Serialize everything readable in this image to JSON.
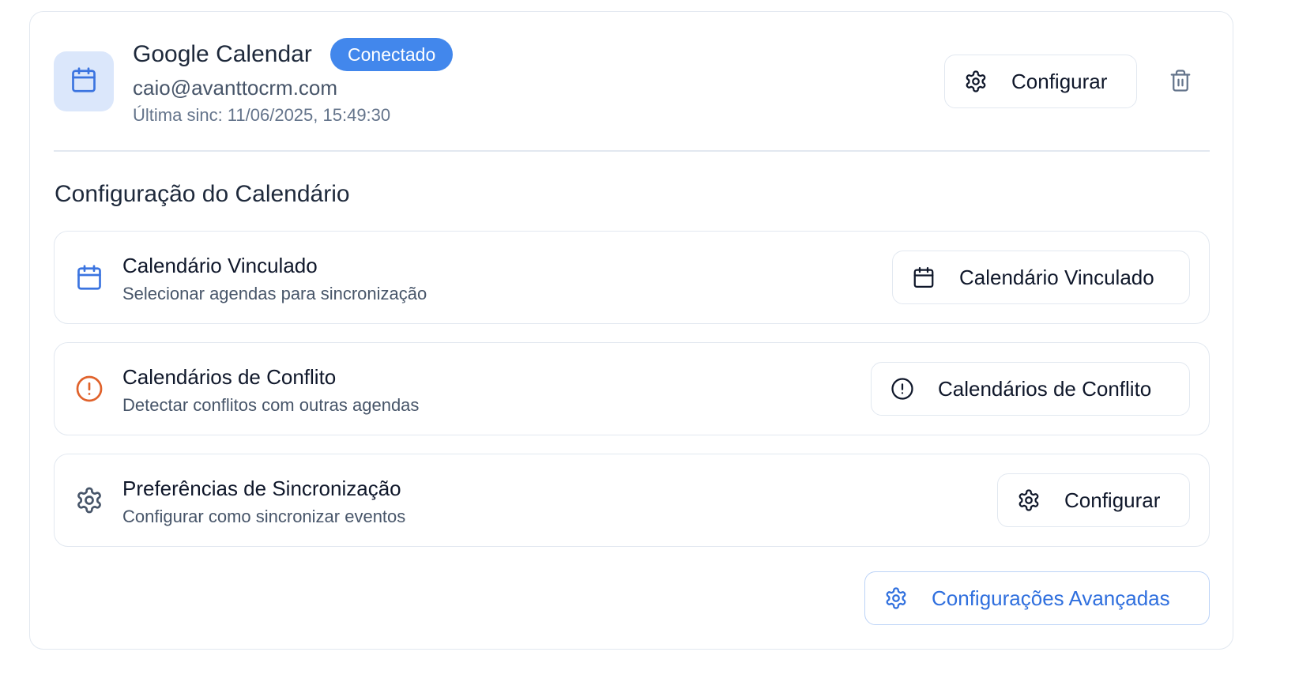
{
  "integration": {
    "name": "Google Calendar",
    "status_badge": "Conectado",
    "account_email": "caio@avanttocrm.com",
    "last_sync": "Última sinc: 11/06/2025, 15:49:30",
    "configure_label": "Configurar",
    "icon": "calendar-icon",
    "delete_icon": "trash-icon"
  },
  "section": {
    "title": "Configuração do Calendário",
    "rows": [
      {
        "icon": "calendar-icon",
        "title": "Calendário Vinculado",
        "subtitle": "Selecionar agendas para sincronização",
        "button_label": "Calendário Vinculado",
        "button_icon": "calendar-icon"
      },
      {
        "icon": "alert-circle-icon",
        "title": "Calendários de Conflito",
        "subtitle": "Detectar conflitos com outras agendas",
        "button_label": "Calendários de Conflito",
        "button_icon": "alert-circle-icon"
      },
      {
        "icon": "gear-icon",
        "title": "Preferências de Sincronização",
        "subtitle": "Configurar como sincronizar eventos",
        "button_label": "Configurar",
        "button_icon": "gear-icon"
      }
    ],
    "advanced_label": "Configurações Avançadas"
  },
  "colors": {
    "accent": "#4287ec",
    "link": "#2f6fde",
    "warning": "#e0622b",
    "icon_bg": "#dbe7fb",
    "border": "#e2e8f0"
  }
}
